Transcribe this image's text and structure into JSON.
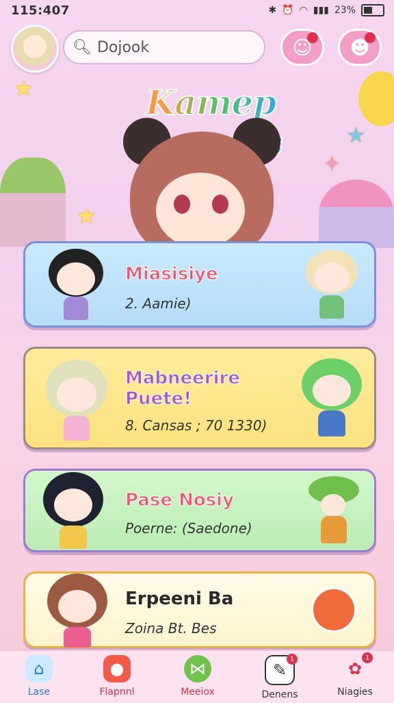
{
  "status": {
    "time": "115:407",
    "battery": "23%"
  },
  "header": {
    "search_value": "Dojook"
  },
  "title": "Kamep Damras",
  "cards": [
    {
      "title": "Miasisiye",
      "subtitle": "2. Aamie)"
    },
    {
      "title": "Mabneerire",
      "title2": "Puete!",
      "subtitle": "8. Cansas ; 70 1330)"
    },
    {
      "title": "Pase Nosiy",
      "subtitle": "Poerne: (Saedone)"
    },
    {
      "title": "Erpeeni Ba",
      "subtitle": "Zoina Bt. Bes"
    }
  ],
  "nav": [
    {
      "label": "Lase",
      "icon": "home-icon",
      "color": "#3aa0e0"
    },
    {
      "label": "Flapnnl",
      "icon": "cat-icon",
      "color": "#e0304e"
    },
    {
      "label": "Meeiox",
      "icon": "bow-icon",
      "color": "#e0304e"
    },
    {
      "label": "Denens",
      "icon": "note-icon",
      "color": "#333333"
    },
    {
      "label": "Niagies",
      "icon": "bell-icon",
      "color": "#333333"
    }
  ],
  "badges": {
    "header_a": "",
    "header_b": "",
    "nav_denens": "1",
    "nav_niagies": "1"
  }
}
